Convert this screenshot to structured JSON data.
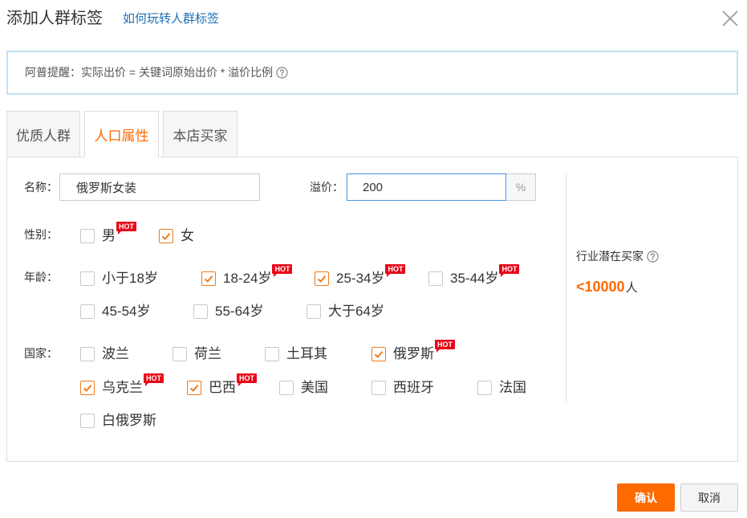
{
  "dialog": {
    "title": "添加人群标签",
    "help_link": "如何玩转人群标签"
  },
  "notice": {
    "text": "阿普提醒：实际出价 = 关键词原始出价 * 溢价比例"
  },
  "tabs": [
    {
      "label": "优质人群",
      "active": false
    },
    {
      "label": "人口属性",
      "active": true
    },
    {
      "label": "本店买家",
      "active": false
    }
  ],
  "form": {
    "name_label": "名称：",
    "name_value": "俄罗斯女装",
    "premium_label": "溢价：",
    "premium_value": "200",
    "premium_unit": "%"
  },
  "potential": {
    "label": "行业潜在买家",
    "value": "<10000",
    "unit": "人"
  },
  "gender": {
    "label": "性别：",
    "options": [
      {
        "label": "男",
        "checked": false,
        "badge": "HOT"
      },
      {
        "label": "女",
        "checked": true
      }
    ]
  },
  "age": {
    "label": "年龄：",
    "options": [
      {
        "label": "小于18岁",
        "checked": false
      },
      {
        "label": "18-24岁",
        "checked": true,
        "badge": "HOT"
      },
      {
        "label": "25-34岁",
        "checked": true,
        "badge": "HOT"
      },
      {
        "label": "35-44岁",
        "checked": false,
        "badge": "HOT"
      },
      {
        "label": "45-54岁",
        "checked": false
      },
      {
        "label": "55-64岁",
        "checked": false
      },
      {
        "label": "大于64岁",
        "checked": false
      }
    ]
  },
  "country": {
    "label": "国家：",
    "options": [
      {
        "label": "波兰",
        "checked": false
      },
      {
        "label": "荷兰",
        "checked": false
      },
      {
        "label": "土耳其",
        "checked": false
      },
      {
        "label": "俄罗斯",
        "checked": true,
        "badge": "HOT"
      },
      {
        "label": "乌克兰",
        "checked": true,
        "badge": "HOT"
      },
      {
        "label": "巴西",
        "checked": true,
        "badge": "HOT"
      },
      {
        "label": "美国",
        "checked": false
      },
      {
        "label": "西班牙",
        "checked": false
      },
      {
        "label": "法国",
        "checked": false
      },
      {
        "label": "白俄罗斯",
        "checked": false
      }
    ]
  },
  "buttons": {
    "confirm": "确认",
    "cancel": "取消"
  },
  "icons": {
    "close": "close-icon",
    "help": "question-circle-icon",
    "checked": "check-icon"
  },
  "colors": {
    "accent": "#ff6a00",
    "checkbox_checked": "#f07b1b",
    "hot_badge": "#e8071a",
    "link": "#1d6fb8",
    "focus_border": "#4a90e2",
    "notice_border": "#c3e1f4"
  }
}
